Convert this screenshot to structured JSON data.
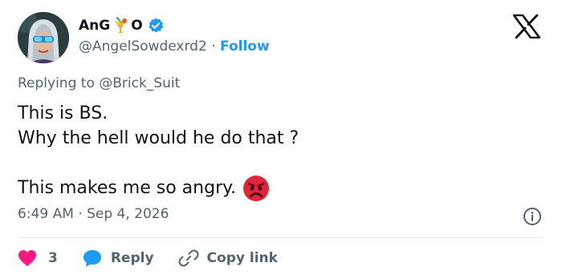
{
  "author": {
    "name": "AnG",
    "name_suffix": "O",
    "handle": "@AngelSowdexrd2",
    "separator": "·",
    "follow_label": "Follow",
    "verified_color": "#1d9bf0"
  },
  "reply": {
    "prefix": "Replying to",
    "mention": "@Brick_Suit"
  },
  "tweet": {
    "line1": "This is BS.",
    "line2": "Why the hell would he do that ?",
    "line3": "This makes me so angry.",
    "emoji": "angry-face-emoji"
  },
  "meta": {
    "time": "6:49 AM",
    "separator": "·",
    "date": "Sep 4, 2026"
  },
  "actions": {
    "like_count": "3",
    "reply_label": "Reply",
    "copy_label": "Copy link"
  },
  "colors": {
    "accent": "#1d9bf0",
    "like": "#f91880",
    "text": "#0f1419",
    "muted": "#536471"
  },
  "icons": [
    "x-logo-icon",
    "verified-badge-icon",
    "tropical-drink-emoji-icon",
    "info-icon",
    "heart-icon",
    "reply-bubble-icon",
    "link-icon"
  ]
}
